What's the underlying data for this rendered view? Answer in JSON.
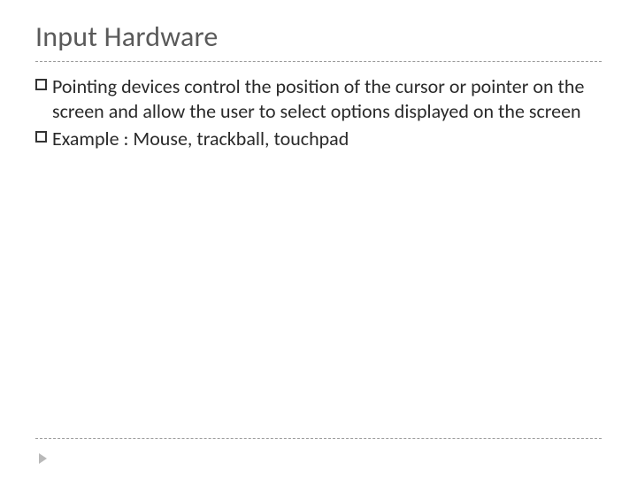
{
  "slide": {
    "title": "Input Hardware",
    "bullets": [
      {
        "term": "Pointing devices",
        "rest": " control the position of the cursor or pointer on the screen and allow the user to select options displayed on the screen"
      },
      {
        "term": "Example",
        "rest": " : Mouse, trackball, touchpad"
      }
    ]
  }
}
